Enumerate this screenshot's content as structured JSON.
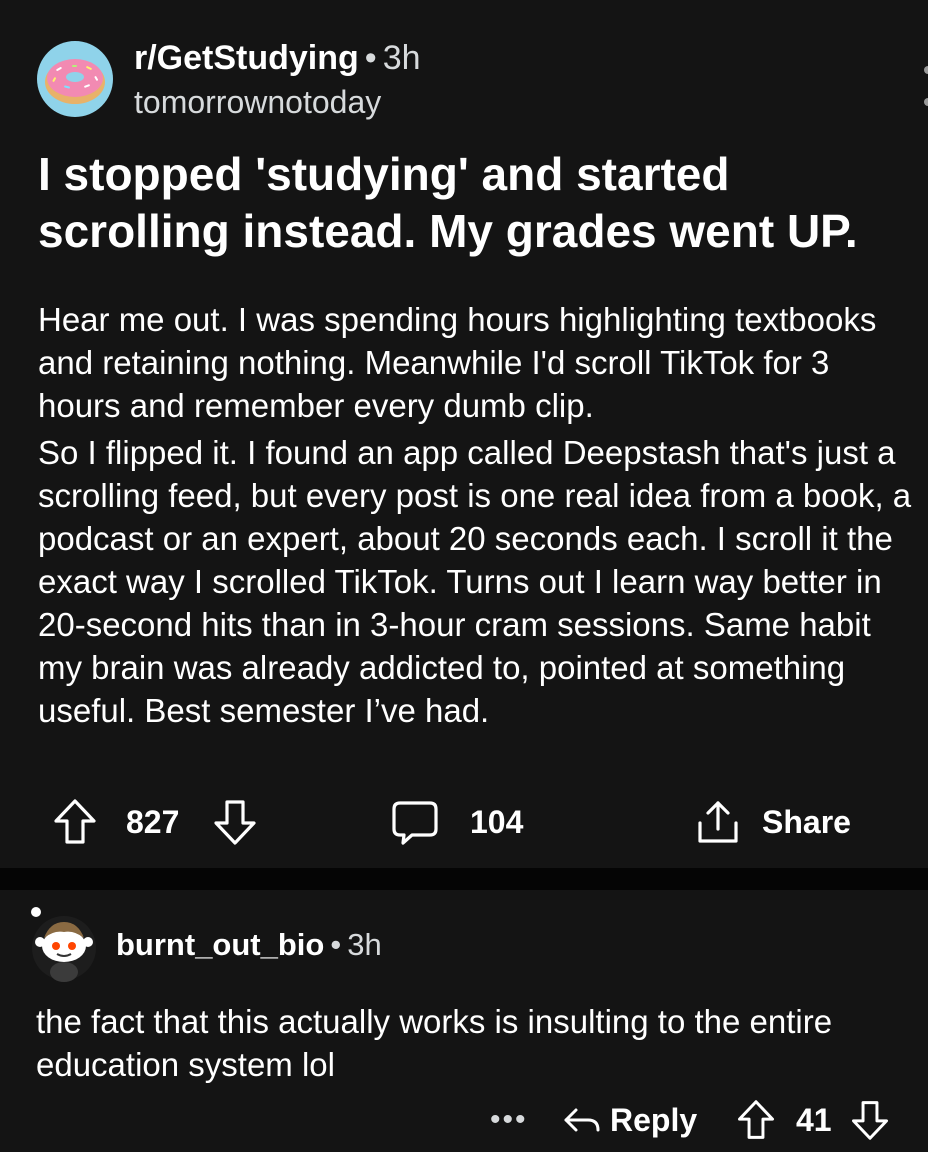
{
  "post": {
    "subreddit": "r/GetStudying",
    "separator": "•",
    "time_ago": "3h",
    "author": "tomorrownotoday",
    "title": "I stopped 'studying' and started scrolling instead. My grades went UP.",
    "body_paragraphs": [
      "Hear me out. I was spending hours highlighting textbooks and retaining nothing. Meanwhile I'd scroll TikTok for 3 hours and remember every dumb clip.",
      "So I flipped it. I found an app called Deepstash that's just a scrolling feed, but every post is one real idea from a book, a podcast or an expert, about 20 seconds each. I scroll it the exact way I scrolled TikTok. Turns out I learn way better in 20-second hits than in 3-hour cram sessions. Same habit my brain was already addicted to, pointed at something useful. Best semester I’ve had."
    ],
    "upvotes": "827",
    "comments_count": "104",
    "share_label": "Share",
    "icons": {
      "avatar": "donut-avatar-icon",
      "upvote": "arrow-up-icon",
      "downvote": "arrow-down-icon",
      "comment": "comment-bubble-icon",
      "share": "share-icon"
    }
  },
  "comment": {
    "author": "burnt_out_bio",
    "separator": "•",
    "time_ago": "3h",
    "text": "the fact that this actually works is insulting to the entire education system lol",
    "more": "•••",
    "reply_label": "Reply",
    "votes": "41",
    "icons": {
      "avatar": "snoo-avatar-icon",
      "reply": "reply-arrow-icon",
      "upvote": "arrow-up-icon",
      "downvote": "arrow-down-icon"
    }
  },
  "colors": {
    "background": "#000000",
    "card": "#141414",
    "text": "#ffffff",
    "muted": "#d7dadc",
    "donut_bg": "#8fd3ea",
    "donut_icing": "#f28ab2"
  }
}
